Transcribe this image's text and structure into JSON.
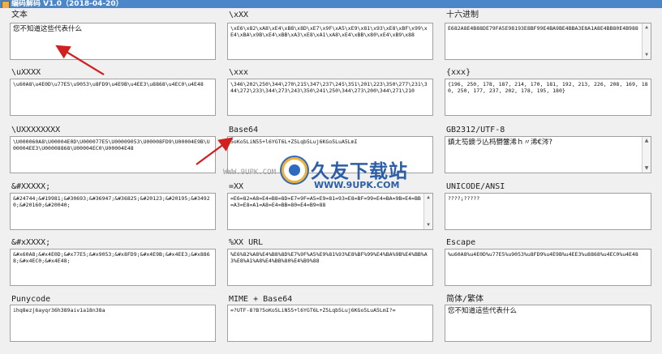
{
  "window": {
    "title": "编码解码 V1.0（2018-04-20）"
  },
  "fields": [
    {
      "label": "文本",
      "value": "您不知道这些代表什么"
    },
    {
      "label": "\\xXX",
      "value": "\\xE6\\x82\\xA8\\xE4\\xB8\\x8D\\xE7\\x9F\\xA5\\xE9\\x81\\x93\\xE8\\xBF\\x99\\xE4\\xBA\\x9B\\xE4\\xBB\\xA3\\xE8\\xA1\\xA8\\xE4\\xBB\\x80\\xE4\\xB9\\x88"
    },
    {
      "label": "十六进制",
      "value": "E682A8E4B88DE79FA5E98193E8BF99E4BA9BE4BBA3E8A1A8E4BB80E4B988"
    },
    {
      "label": "\\uXXXX",
      "value": "\\u60A8\\u4E0D\\u77E5\\u9053\\u8FD9\\u4E9B\\u4EE3\\u8868\\u4EC0\\u4E48"
    },
    {
      "label": "\\xxx",
      "value": "\\346\\202\\250\\344\\270\\215\\347\\237\\245\\351\\201\\223\\350\\277\\231\\344\\272\\233\\344\\273\\243\\350\\241\\250\\344\\273\\200\\344\\271\\210"
    },
    {
      "label": "{xxx}",
      "value": "{196, 250, 178, 187, 214, 170, 181, 192, 213, 226, 208, 169, 180, 250, 177, 237, 202, 178, 195, 180}"
    },
    {
      "label": "\\UXXXXXXXX",
      "value": "\\U000060A8\\U00004E0D\\U000077E5\\U00009053\\U00008FD9\\U00004E9B\\U00004EE3\\U00008868\\U00004EC0\\U00004E48"
    },
    {
      "label": "Base64",
      "value": "5oKo5LiN55+l6YGT6L+Z5Lqb5Luj6KGo5LuA5LmI"
    },
    {
      "label": "GB2312/UTF-8",
      "value": "鎮ㄤ笉鐭ラ亾杩欎簺浠ｈ〃浠€涔?"
    },
    {
      "label": "&#XXXXX;",
      "value": "&#24744;&#19981;&#30693;&#36947;&#36825;&#20123;&#20195;&#34920;&#20160;&#20040;"
    },
    {
      "label": "=XX",
      "value": "=E6=82=A8=E4=B8=8D=E7=9F=A5=E9=81=93=E8=BF=99=E4=BA=9B=E4=BB=A3=E8=A1=A8=E4=BB=80=E4=B9=88"
    },
    {
      "label": "UNICODE/ANSI",
      "value": "????¡?????"
    },
    {
      "label": "&#xXXXX;",
      "value": "&#x60A8;&#x4E0D;&#x77E5;&#x9053;&#x8FD9;&#x4E9B;&#x4EE3;&#x8868;&#x4EC0;&#x4E48;"
    },
    {
      "label": "%XX  URL",
      "value": "%E6%82%A8%E4%B8%8D%E7%9F%A5%E9%81%93%E8%BF%99%E4%BA%9B%E4%BB%A3%E8%A1%A8%E4%BB%80%E4%B9%88"
    },
    {
      "label": "Escape",
      "value": "%u60A8%u4E0D%u77E5%u9053%u8FD9%u4E9B%u4EE3%u8868%u4EC0%u4E48"
    },
    {
      "label": "Punycode",
      "value": "ihq8ezj6ayqr36h389aiv1a18n38a"
    },
    {
      "label": "MIME + Base64",
      "value": "=?UTF-8?B?5oKo5LiN55+l6YGT6L+Z5Lqb5Luj6KGo5LuA5LmI?="
    },
    {
      "label": "简体/繁体",
      "value": "您不知道這些代表什么"
    }
  ],
  "watermark": {
    "site": "WWW.9UPK.COM",
    "name": "久友下载站",
    "url": "WWW.9UPK.COM"
  },
  "colors": {
    "titlebar": "#4a86c8",
    "arrow": "#d02020",
    "field_border": "#a0a0a0"
  }
}
